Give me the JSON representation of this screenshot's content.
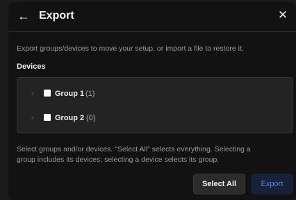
{
  "dialog": {
    "title": "Export",
    "back_icon": "←",
    "close_icon": "✕",
    "description": "Export groups/devices to move your setup, or import a file to restore it.",
    "section_title": "Devices"
  },
  "tree": {
    "items": [
      {
        "label": "Group 1",
        "count": "(1)",
        "checked": false,
        "expanded": false
      },
      {
        "label": "Group 2",
        "count": "(0)",
        "checked": false,
        "expanded": false
      }
    ],
    "chevron_icon": "›"
  },
  "help": {
    "line1": "Select groups and/or devices. \"Select All\" selects everything. Selecting a",
    "line2": "group includes its devices; selecting a device selects its group."
  },
  "actions": {
    "select_all": "Select All",
    "export": "Export"
  },
  "colors": {
    "background": "#121212",
    "accent_text": "#5c7fd0",
    "accent_bg": "#17213a"
  }
}
